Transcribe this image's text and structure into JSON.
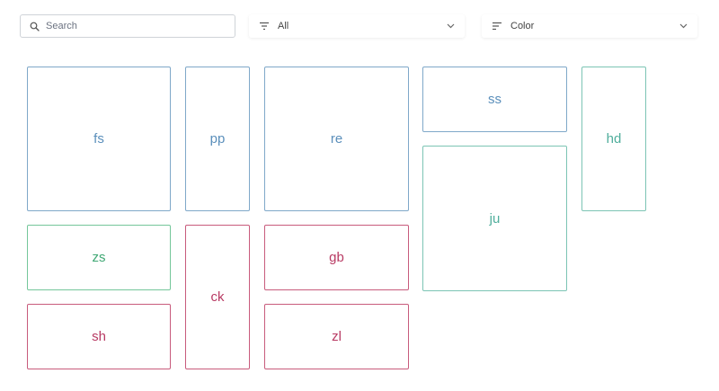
{
  "toolbar": {
    "search": {
      "placeholder": "Search",
      "value": "",
      "icon": "search-icon"
    },
    "filter": {
      "label": "All",
      "icon": "filter-lines-icon"
    },
    "sort": {
      "label": "Color",
      "icon": "sort-lines-icon"
    }
  },
  "colors": {
    "blue": "#5b8fbb",
    "teal": "#4fae9c",
    "green": "#3fa874",
    "red": "#b83a63"
  },
  "tiles": [
    {
      "id": "fs",
      "label": "fs",
      "color": "blue"
    },
    {
      "id": "pp",
      "label": "pp",
      "color": "blue"
    },
    {
      "id": "re",
      "label": "re",
      "color": "blue"
    },
    {
      "id": "ss",
      "label": "ss",
      "color": "blue"
    },
    {
      "id": "hd",
      "label": "hd",
      "color": "teal"
    },
    {
      "id": "ju",
      "label": "ju",
      "color": "teal"
    },
    {
      "id": "zs",
      "label": "zs",
      "color": "green"
    },
    {
      "id": "ck",
      "label": "ck",
      "color": "red"
    },
    {
      "id": "gb",
      "label": "gb",
      "color": "red"
    },
    {
      "id": "sh",
      "label": "sh",
      "color": "red"
    },
    {
      "id": "zl",
      "label": "zl",
      "color": "red"
    }
  ]
}
